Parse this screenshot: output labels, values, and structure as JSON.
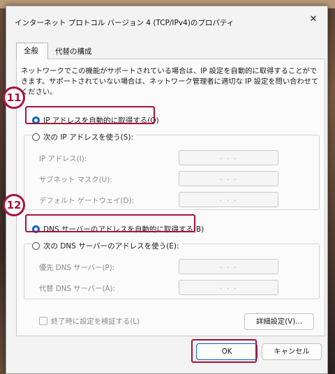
{
  "window": {
    "title": "インターネット プロトコル バージョン 4 (TCP/IPv4)のプロパティ",
    "close_glyph": "✕"
  },
  "tabs": [
    {
      "label": "全般",
      "active": true
    },
    {
      "label": "代替の構成",
      "active": false
    }
  ],
  "description": "ネットワークでこの機能がサポートされている場合は、IP 設定を自動的に取得することができます。サポートされていない場合は、ネットワーク管理者に適切な IP 設定を問い合わせてください。",
  "ip_section": {
    "auto_label": "IP アドレスを自動的に取得する(O)",
    "manual_label": "次の IP アドレスを使う(S):",
    "selected": "auto",
    "fields": [
      {
        "label": "IP アドレス(I):",
        "value": ". . ."
      },
      {
        "label": "サブネット マスク(U):",
        "value": ". . ."
      },
      {
        "label": "デフォルト ゲートウェイ(D):",
        "value": ". . ."
      }
    ]
  },
  "dns_section": {
    "auto_label": "DNS サーバーのアドレスを自動的に取得する(B)",
    "manual_label": "次の DNS サーバーのアドレスを使う(E):",
    "selected": "auto",
    "fields": [
      {
        "label": "優先 DNS サーバー(P):",
        "value": ". . ."
      },
      {
        "label": "代替 DNS サーバー(A):",
        "value": ". . ."
      }
    ]
  },
  "validate_checkbox": {
    "label": "終了時に設定を検証する(L)",
    "checked": false
  },
  "advanced_button": "詳細設定(V)...",
  "ok_button": "OK",
  "cancel_button": "キャンセル",
  "annotations": {
    "badge_1": "11",
    "badge_2": "12",
    "accent_color": "#a8123a",
    "radio_color": "#0067c0"
  }
}
